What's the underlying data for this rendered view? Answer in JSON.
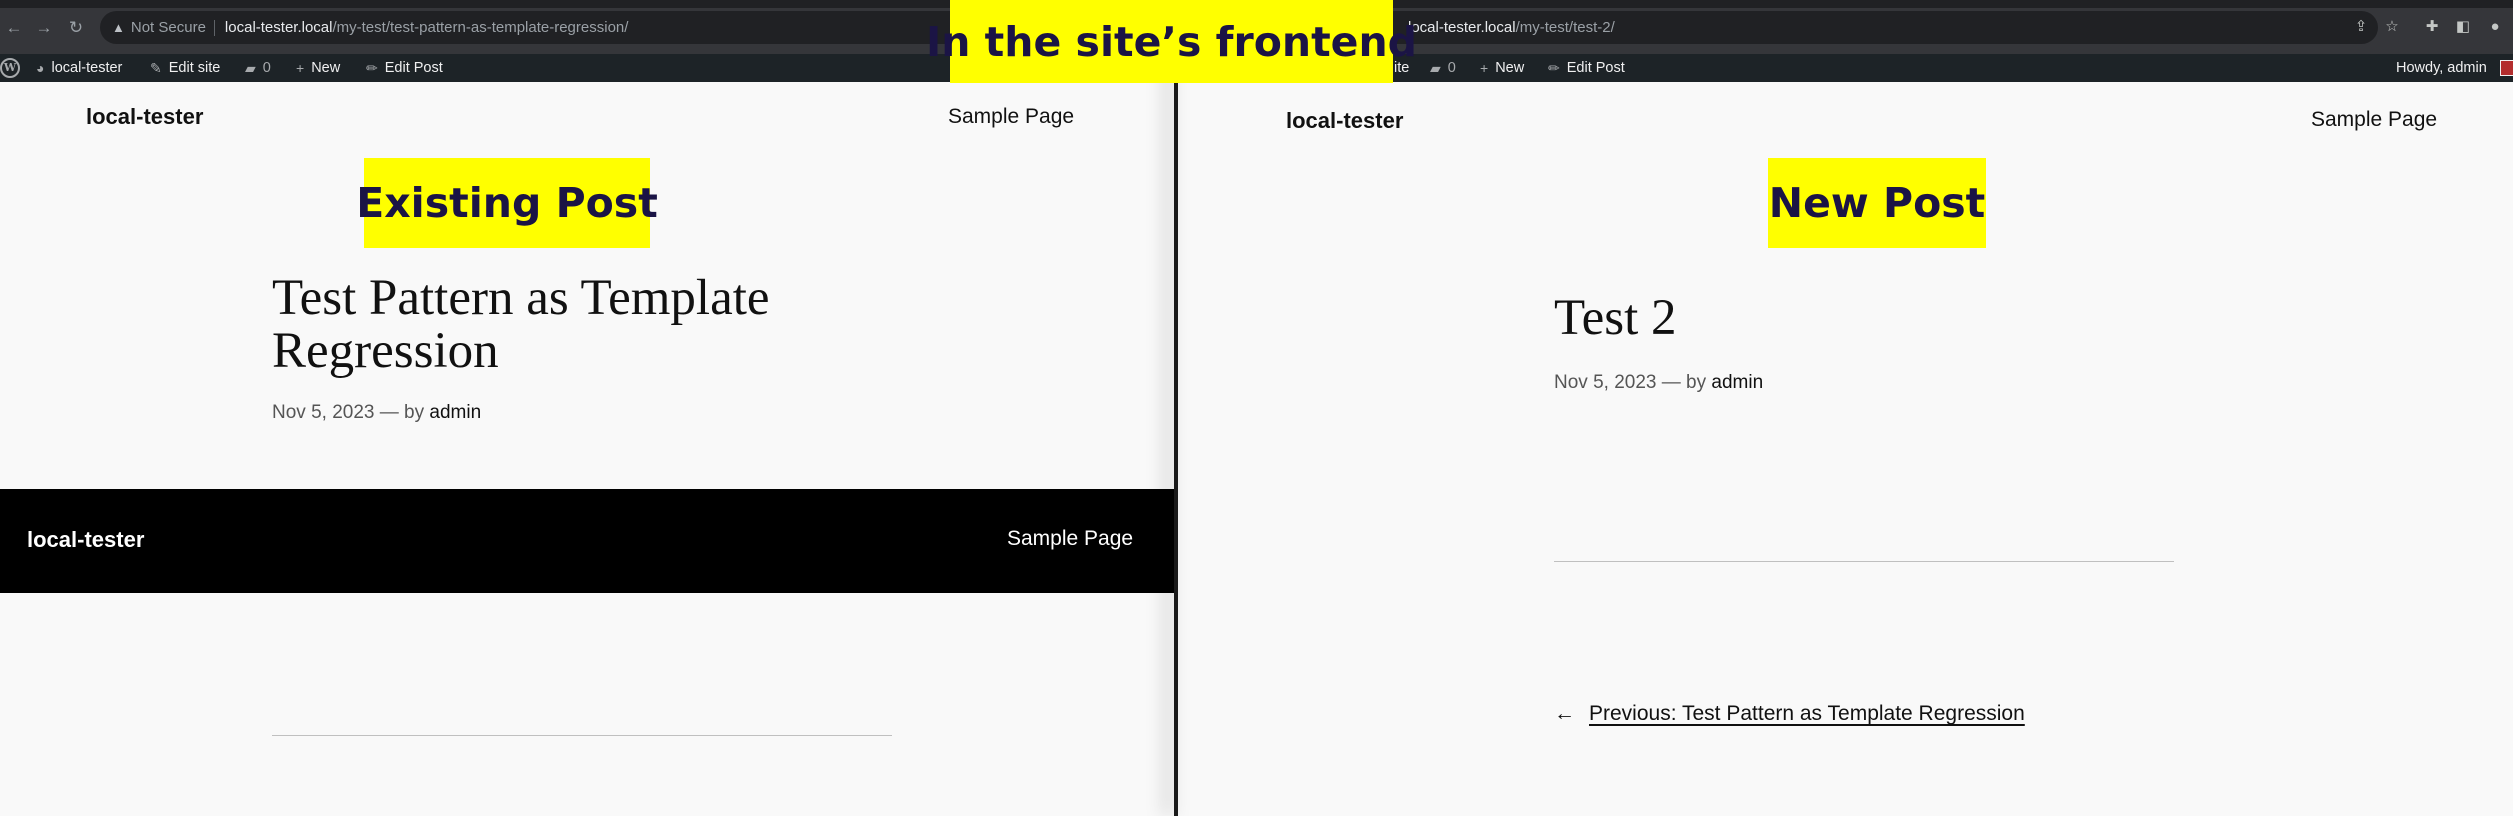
{
  "annotations": {
    "main": "In the site’s frontend",
    "existing": "Existing Post",
    "new": "New Post"
  },
  "left": {
    "browser": {
      "security": "Not Secure",
      "url_host": "local-tester.local",
      "url_path": "/my-test/test-pattern-as-template-regression/"
    },
    "adminbar": {
      "site": "local-tester",
      "edit_site": "Edit site",
      "comments": "0",
      "new": "New",
      "edit_post": "Edit Post"
    },
    "header": {
      "site_title": "local-tester",
      "nav": "Sample Page"
    },
    "post": {
      "title": "Test Pattern as Template Regression",
      "date": "Nov 5, 2023",
      "by": "— by",
      "author": "admin"
    },
    "footer": {
      "site_title": "local-tester",
      "nav": "Sample Page"
    }
  },
  "right": {
    "browser": {
      "url_host": "local-tester.local",
      "url_path": "/my-test/test-2/"
    },
    "adminbar": {
      "site_partial": "ite",
      "comments": "0",
      "new": "New",
      "edit_post": "Edit Post",
      "howdy": "Howdy, admin"
    },
    "header": {
      "site_title": "local-tester",
      "nav": "Sample Page"
    },
    "post": {
      "title": "Test 2",
      "date": "Nov 5, 2023",
      "by": "— by",
      "author": "admin"
    },
    "prev": {
      "arrow": "←",
      "label": "Previous: Test Pattern as Template Regression"
    }
  },
  "icons": {
    "back": "left-arrow-icon",
    "forward": "right-arrow-icon",
    "reload": "reload-icon",
    "warning": "warning-icon",
    "wordpress": "wordpress-logo-icon",
    "dashboard": "dashboard-icon",
    "brush": "brush-icon",
    "comment": "comment-icon",
    "plus": "plus-icon",
    "pencil": "pencil-icon",
    "share": "share-icon",
    "star": "star-icon",
    "extensions": "puzzle-icon",
    "sidebar": "sidebar-icon",
    "profile": "profile-icon"
  },
  "colors": {
    "annotation_bg": "#ffff00",
    "annotation_text": "#1b1445",
    "adminbar_bg": "#1d2327",
    "footer_bg": "#000000"
  }
}
